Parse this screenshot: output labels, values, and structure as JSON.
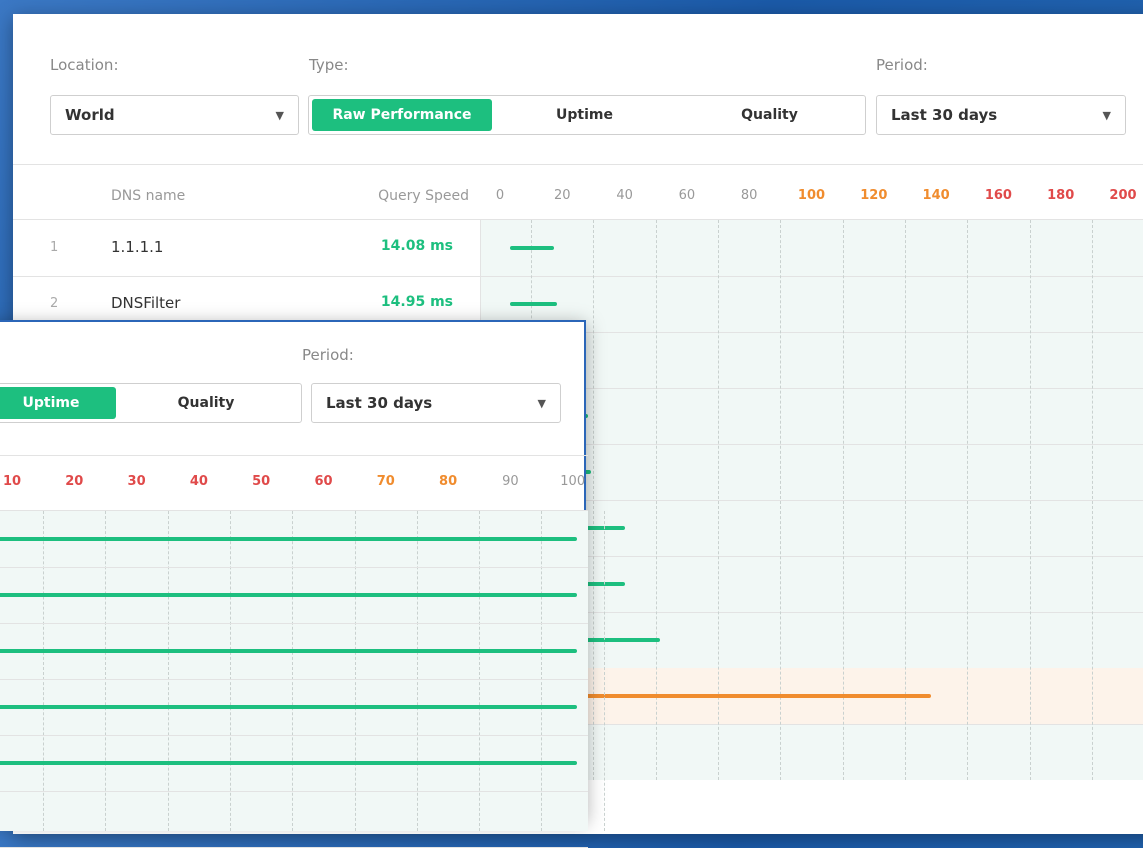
{
  "performance": {
    "location_label": "Location:",
    "location_value": "World",
    "type_label": "Type:",
    "type_options": [
      "Raw Performance",
      "Uptime",
      "Quality"
    ],
    "type_active": "Raw Performance",
    "period_label": "Period:",
    "period_value": "Last 30 days",
    "headers": {
      "dns_name": "DNS name",
      "query_speed": "Query Speed"
    },
    "axis_ticks": [
      {
        "label": "0",
        "color": "#999999"
      },
      {
        "label": "20",
        "color": "#999999"
      },
      {
        "label": "40",
        "color": "#999999"
      },
      {
        "label": "60",
        "color": "#999999"
      },
      {
        "label": "80",
        "color": "#999999"
      },
      {
        "label": "100",
        "color": "#f08c2e"
      },
      {
        "label": "120",
        "color": "#f08c2e"
      },
      {
        "label": "140",
        "color": "#f08c2e"
      },
      {
        "label": "160",
        "color": "#e04a4a"
      },
      {
        "label": "180",
        "color": "#e04a4a"
      },
      {
        "label": "200",
        "color": "#e04a4a"
      }
    ],
    "rows": [
      {
        "rank": "1",
        "name": "1.1.1.1",
        "speed": "14.08 ms",
        "value": 14.08
      },
      {
        "rank": "2",
        "name": "DNSFilter",
        "speed": "14.95 ms",
        "value": 14.95
      }
    ],
    "hidden_row_bars": [
      {
        "value": 23,
        "color": "#1dbf7f"
      },
      {
        "value": 25,
        "color": "#1dbf7f"
      },
      {
        "value": 26,
        "color": "#1dbf7f"
      },
      {
        "value": 37,
        "color": "#1dbf7f"
      },
      {
        "value": 37,
        "color": "#1dbf7f"
      },
      {
        "value": 48,
        "color": "#1dbf7f"
      },
      {
        "value": 135,
        "color": "#f08c2e"
      }
    ]
  },
  "uptime": {
    "period_label": "Period:",
    "type_options": [
      "Uptime",
      "Quality"
    ],
    "type_active": "Uptime",
    "period_value": "Last 30 days",
    "axis_ticks": [
      {
        "label": "10",
        "color": "#e04a4a"
      },
      {
        "label": "20",
        "color": "#e04a4a"
      },
      {
        "label": "30",
        "color": "#e04a4a"
      },
      {
        "label": "40",
        "color": "#e04a4a"
      },
      {
        "label": "50",
        "color": "#e04a4a"
      },
      {
        "label": "60",
        "color": "#e04a4a"
      },
      {
        "label": "70",
        "color": "#f08c2e"
      },
      {
        "label": "80",
        "color": "#f08c2e"
      },
      {
        "label": "90",
        "color": "#999999"
      },
      {
        "label": "100",
        "color": "#999999"
      }
    ],
    "bars": [
      100,
      100,
      100,
      100,
      100
    ]
  },
  "colors": {
    "accent": "#1dbf7f",
    "warning": "#f08c2e",
    "danger": "#e04a4a"
  }
}
